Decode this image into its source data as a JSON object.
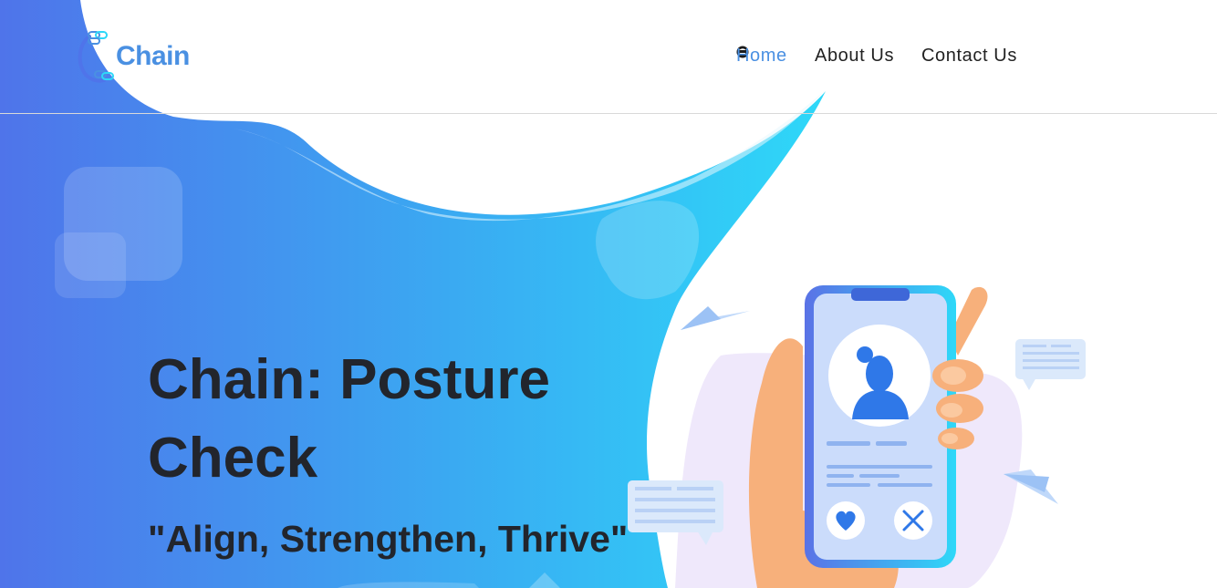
{
  "brand": {
    "name": "Chain"
  },
  "nav": {
    "items": [
      {
        "label": "Home",
        "active": true
      },
      {
        "label": "About Us",
        "active": false
      },
      {
        "label": "Contact Us",
        "active": false
      }
    ],
    "user_icon": "user-icon"
  },
  "hero": {
    "title": "Chain: Posture Check",
    "tagline": "\"Align, Strengthen, Thrive\""
  },
  "colors": {
    "accent": "#4a90e2",
    "gradient_start": "#4f74ea",
    "gradient_end": "#2ed8f8",
    "heading": "#22252c"
  }
}
